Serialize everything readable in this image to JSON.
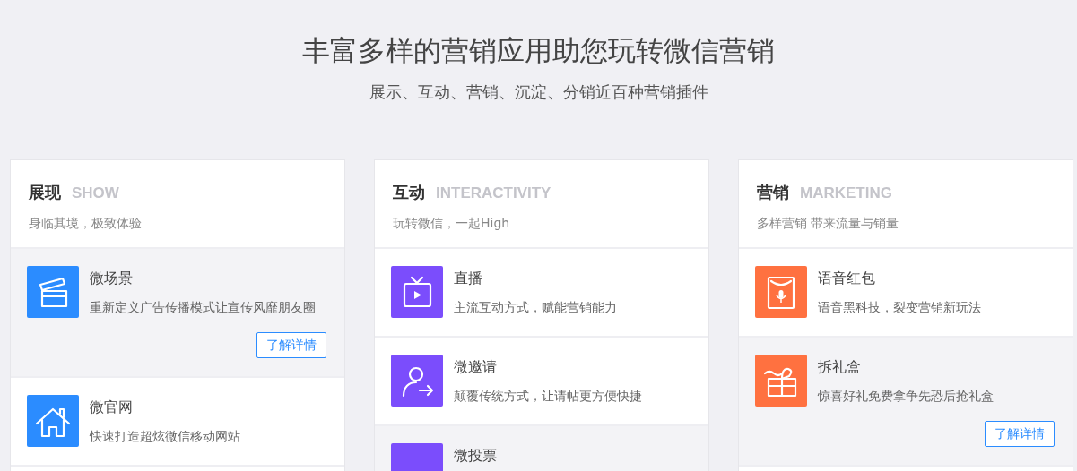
{
  "hero": {
    "title": "丰富多样的营销应用助您玩转微信营销",
    "subtitle": "展示、互动、营销、沉淀、分销近百种营销插件"
  },
  "categories": [
    {
      "name": "展现",
      "english": "SHOW",
      "tagline": "身临其境，极致体验",
      "color": "#2b8cff",
      "items": [
        {
          "title": "微场景",
          "description": "重新定义广告传播模式让宣传风靡朋友圈",
          "selected": true,
          "button": "了解详情"
        },
        {
          "title": "微官网",
          "description": "快速打造超炫微信移动网站",
          "selected": false
        }
      ]
    },
    {
      "name": "互动",
      "english": "INTERACTIVITY",
      "tagline": "玩转微信，一起High",
      "color": "#7b4dfc",
      "items": [
        {
          "title": "直播",
          "description": "主流互动方式，赋能营销能力",
          "selected": false
        },
        {
          "title": "微邀请",
          "description": "颠覆传统方式，让请帖更方便快捷",
          "selected": false
        },
        {
          "title": "微投票",
          "selected": true
        }
      ]
    },
    {
      "name": "营销",
      "english": "MARKETING",
      "tagline": "多样营销 带来流量与销量",
      "color": "#ff7140",
      "items": [
        {
          "title": "语音红包",
          "description": "语音黑科技，裂变营销新玩法",
          "selected": false
        },
        {
          "title": "拆礼盒",
          "description": "惊喜好礼免费拿争先恐后抢礼盒",
          "selected": true,
          "button": "了解详情"
        }
      ]
    }
  ]
}
